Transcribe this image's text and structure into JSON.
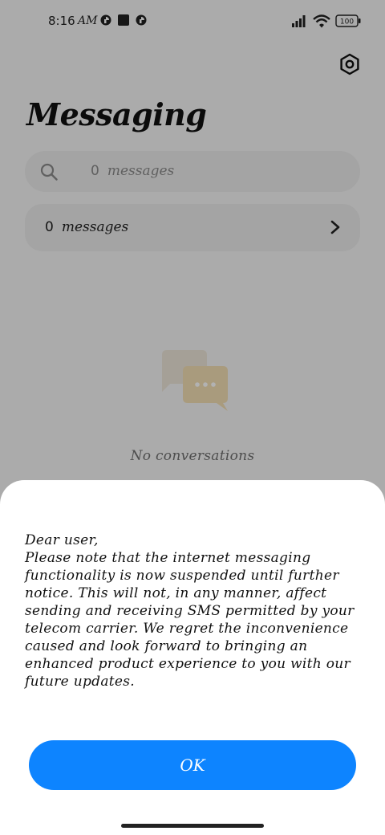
{
  "status_bar": {
    "time": "8:16",
    "ampm": "AM",
    "battery": "100"
  },
  "header": {
    "title": "Messaging"
  },
  "search": {
    "count": "0",
    "label": "messages"
  },
  "summary_row": {
    "count": "0",
    "label": "messages"
  },
  "empty_state": {
    "text": "No conversations"
  },
  "dialog": {
    "greeting": "Dear user,",
    "body": "Please note that the internet messaging\nfunctionality is now suspended until further\nnotice. This will not, in any manner, affect\nsending and receiving SMS permitted by your\ntelecom carrier. We regret the inconvenience\ncaused and look forward to bringing an\nenhanced product experience to you with our\nfuture updates.",
    "ok_label": "OK"
  },
  "colors": {
    "accent": "#0d84ff",
    "scrim": "rgba(0,0,0,0.30)"
  },
  "icons": [
    "settings-icon",
    "search-icon",
    "chevron-right-icon",
    "chat-bubbles-icon",
    "signal-icon",
    "wifi-icon",
    "battery-icon"
  ]
}
